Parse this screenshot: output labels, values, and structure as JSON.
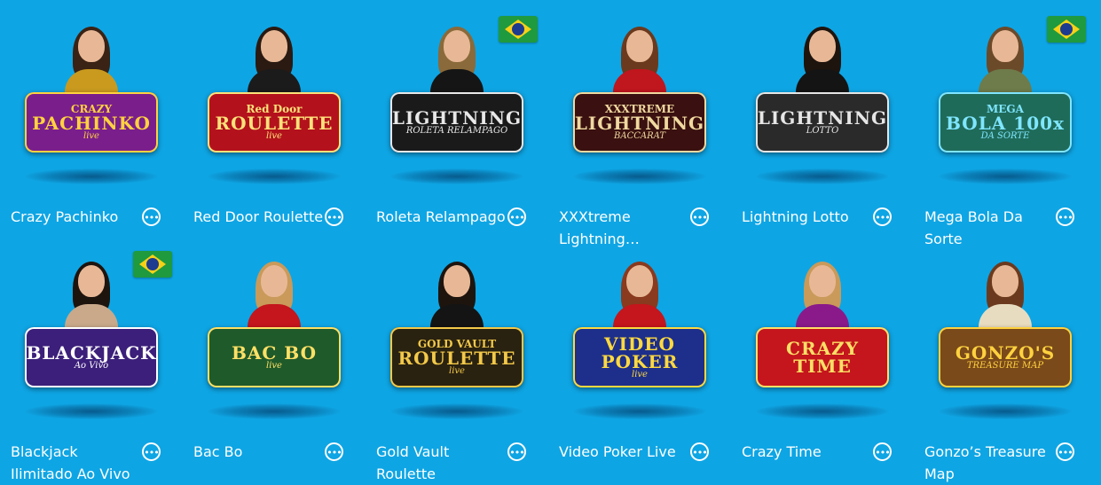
{
  "more_icon_glyph": "•••",
  "games": [
    {
      "title": "Crazy Pachinko",
      "logo": [
        "CRAZY",
        "PACHINKO",
        "live"
      ],
      "flag": false,
      "colors": {
        "logo_bg": "#7a1e8c",
        "logo_text": "#ffd23f",
        "torso": "#c99a1e",
        "hair": "#3a2214"
      }
    },
    {
      "title": "Red Door Roulette",
      "logo": [
        "Red Door",
        "ROULETTE",
        "live"
      ],
      "flag": false,
      "colors": {
        "logo_bg": "#b3121c",
        "logo_text": "#ffe27a",
        "torso": "#1b1b1b",
        "hair": "#2a1a12"
      }
    },
    {
      "title": "Roleta Relampago",
      "logo": [
        "",
        "LIGHTNING",
        "ROLETA RELAMPAGO"
      ],
      "flag": true,
      "colors": {
        "logo_bg": "#1a1a1a",
        "logo_text": "#e8e8e8",
        "torso": "#151515",
        "hair": "#8a6a3a"
      }
    },
    {
      "title": "XXXtreme Lightning…",
      "logo": [
        "XXXTREME",
        "LIGHTNING",
        "BACCARAT"
      ],
      "flag": false,
      "colors": {
        "logo_bg": "#3a1010",
        "logo_text": "#f0d9a0",
        "torso": "#c0161e",
        "hair": "#6b3a1e"
      }
    },
    {
      "title": "Lightning Lotto",
      "logo": [
        "",
        "LIGHTNING",
        "LOTTO"
      ],
      "flag": false,
      "colors": {
        "logo_bg": "#2a2a2a",
        "logo_text": "#e6e6e6",
        "torso": "#141414",
        "hair": "#1e140e"
      }
    },
    {
      "title": "Mega Bola Da Sorte",
      "logo": [
        "MEGA",
        "BOLA 100x",
        "DA SORTE"
      ],
      "flag": true,
      "colors": {
        "logo_bg": "#1f6b5a",
        "logo_text": "#7fe6ff",
        "torso": "#6e7b4a",
        "hair": "#6b4a2a"
      }
    },
    {
      "title": "Blackjack Ilimitado Ao Vivo",
      "logo": [
        "",
        "BLACKJACK",
        "Ao Vivo"
      ],
      "flag": true,
      "colors": {
        "logo_bg": "#3b1f7a",
        "logo_text": "#ffffff",
        "torso": "#c9a98a",
        "hair": "#1e140e"
      }
    },
    {
      "title": "Bac Bo",
      "logo": [
        "",
        "BAC BO",
        "live"
      ],
      "flag": false,
      "colors": {
        "logo_bg": "#1f5a2a",
        "logo_text": "#ffe066",
        "torso": "#c4161c",
        "hair": "#c99a5a"
      }
    },
    {
      "title": "Gold Vault Roulette",
      "logo": [
        "GOLD VAULT",
        "ROULETTE",
        "live"
      ],
      "flag": false,
      "colors": {
        "logo_bg": "#2a2210",
        "logo_text": "#f3c94a",
        "torso": "#141414",
        "hair": "#1e140e"
      }
    },
    {
      "title": "Video Poker Live",
      "logo": [
        "",
        "VIDEO POKER",
        "live"
      ],
      "flag": false,
      "colors": {
        "logo_bg": "#1d2f8a",
        "logo_text": "#ffd93f",
        "torso": "#c4161c",
        "hair": "#8a3a1e"
      }
    },
    {
      "title": "Crazy Time",
      "logo": [
        "",
        "CRAZY TIME",
        ""
      ],
      "flag": false,
      "colors": {
        "logo_bg": "#c4161c",
        "logo_text": "#ffe066",
        "torso": "#8a1a8a",
        "hair": "#c99a5a"
      }
    },
    {
      "title": "Gonzo’s Treasure Map",
      "logo": [
        "",
        "GONZO'S",
        "TREASURE MAP"
      ],
      "flag": false,
      "colors": {
        "logo_bg": "#7a4a1a",
        "logo_text": "#ffd23f",
        "torso": "#e8dcc0",
        "hair": "#6b3a1e"
      }
    }
  ]
}
